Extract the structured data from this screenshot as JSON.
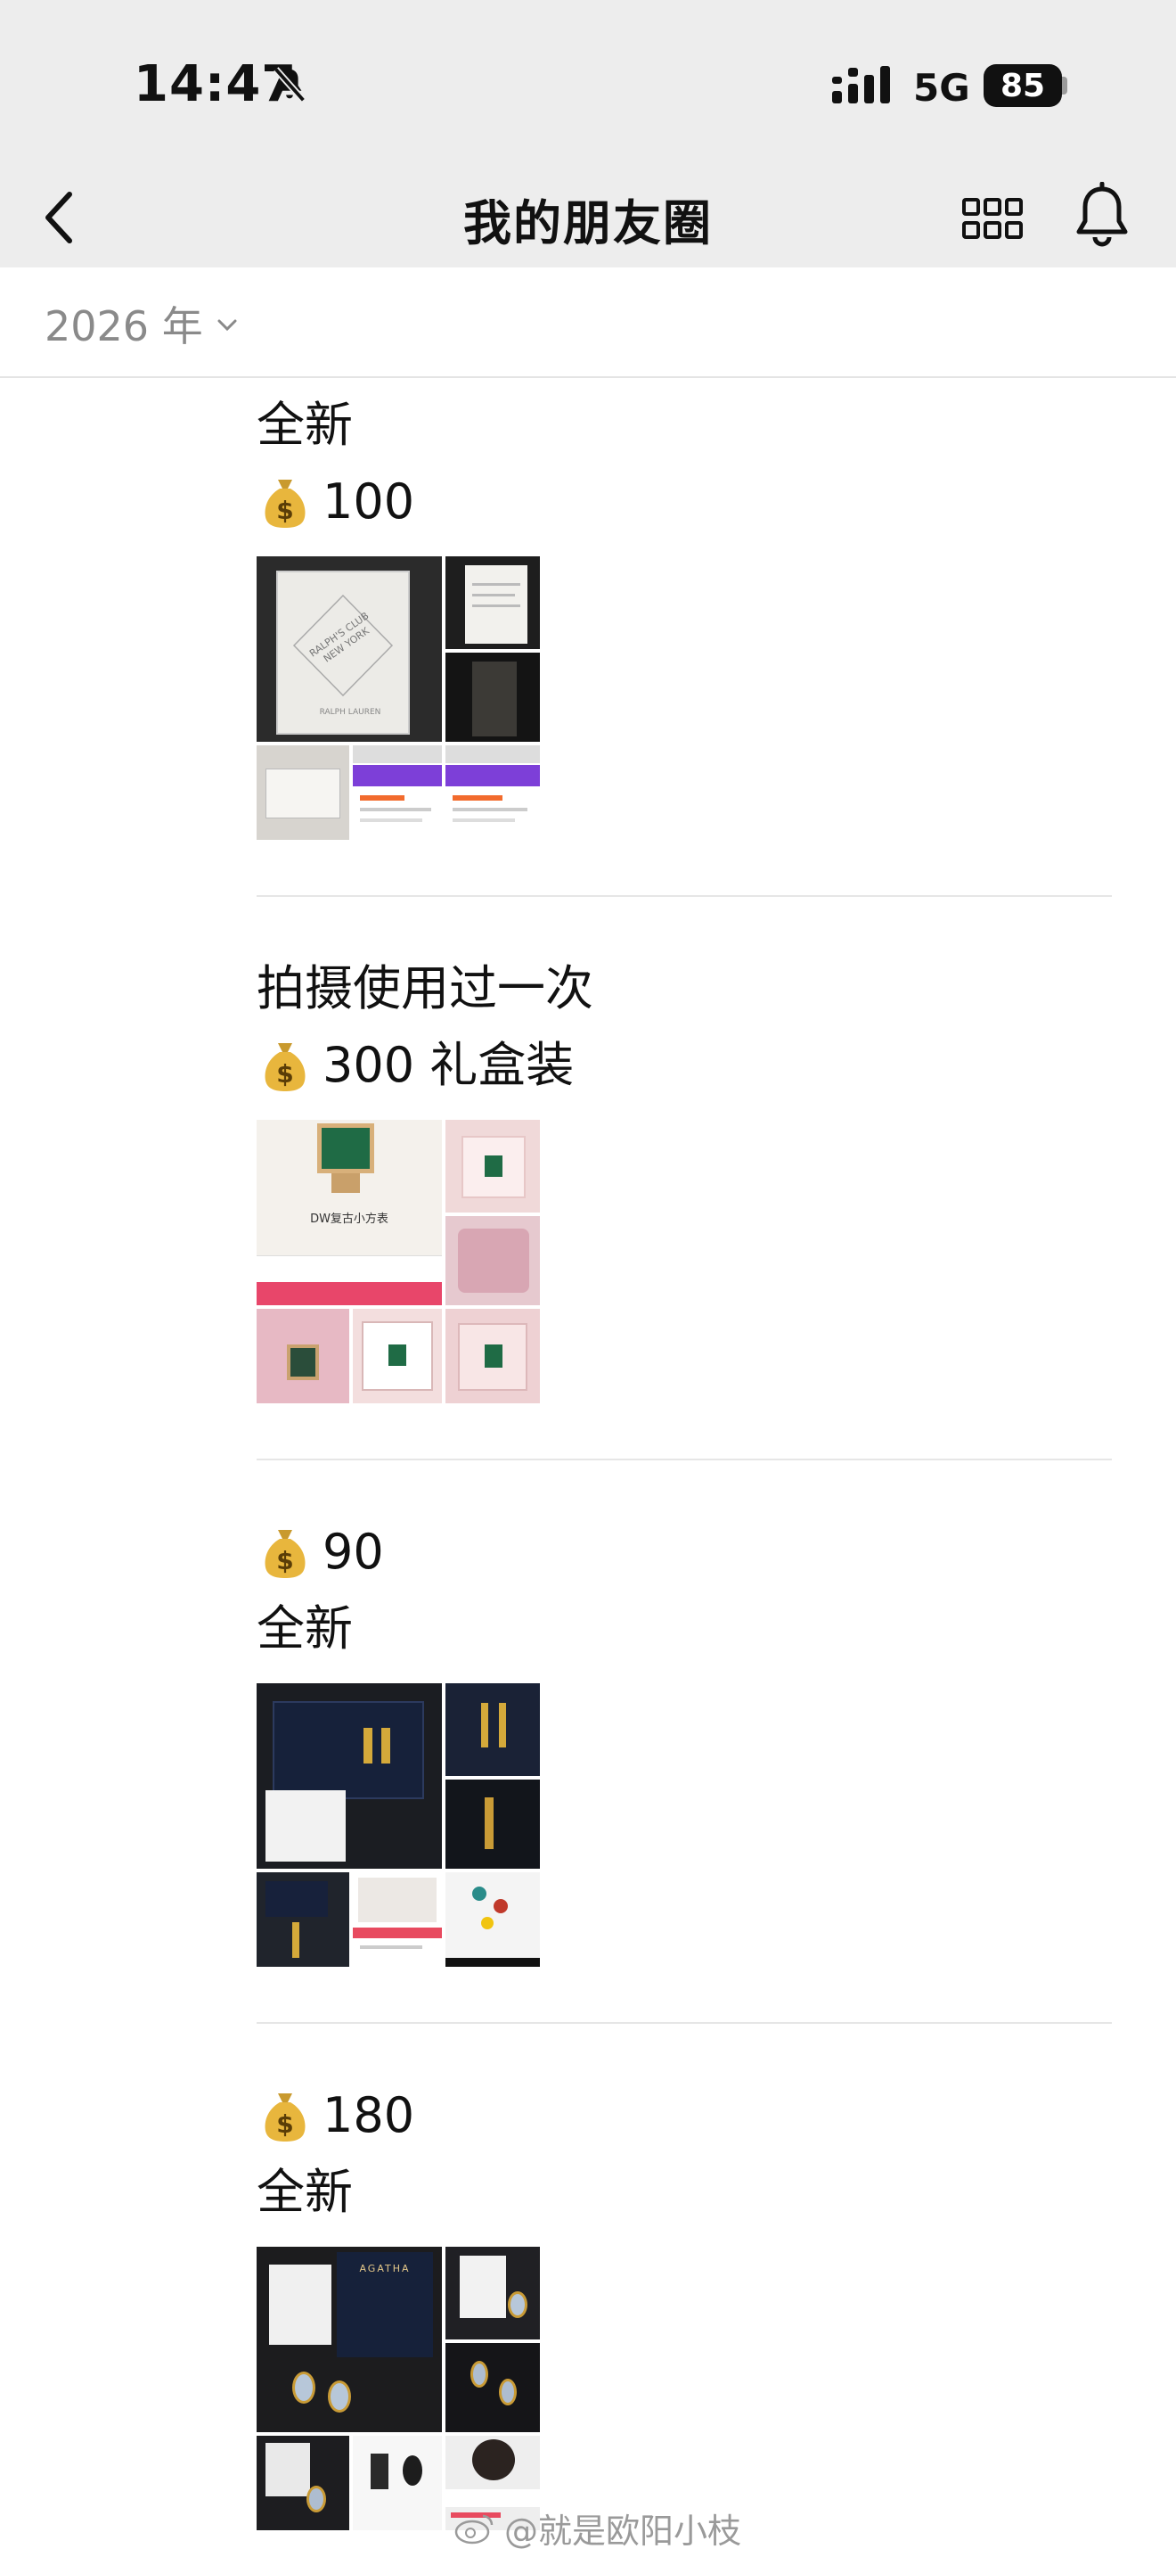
{
  "status_bar": {
    "time": "14:47",
    "network": "5G",
    "battery": "85"
  },
  "nav": {
    "title": "我的朋友圈"
  },
  "filter": {
    "year": "2026 年"
  },
  "posts": [
    {
      "line1": "全新",
      "line2": "100",
      "order": "text-then-price"
    },
    {
      "line1": "拍摄使用过一次",
      "line2": "300 礼盒装",
      "order": "text-then-price"
    },
    {
      "line1": "90",
      "line2": "全新",
      "order": "price-then-text"
    },
    {
      "line1": "180",
      "line2": "全新",
      "order": "price-then-text"
    }
  ],
  "thumb_texts": {
    "perfume_box": "RALPH'S CLUB NEW YORK",
    "perfume_brand": "RALPH LAUREN",
    "watch_caption": "DW复古小方表",
    "earring_brand": "AGATHA"
  },
  "watermark": "@就是欧阳小枝",
  "colors": {
    "chrome_bg": "#ededed",
    "divider": "#e6e6e6",
    "year_text": "#8a8a8a"
  }
}
